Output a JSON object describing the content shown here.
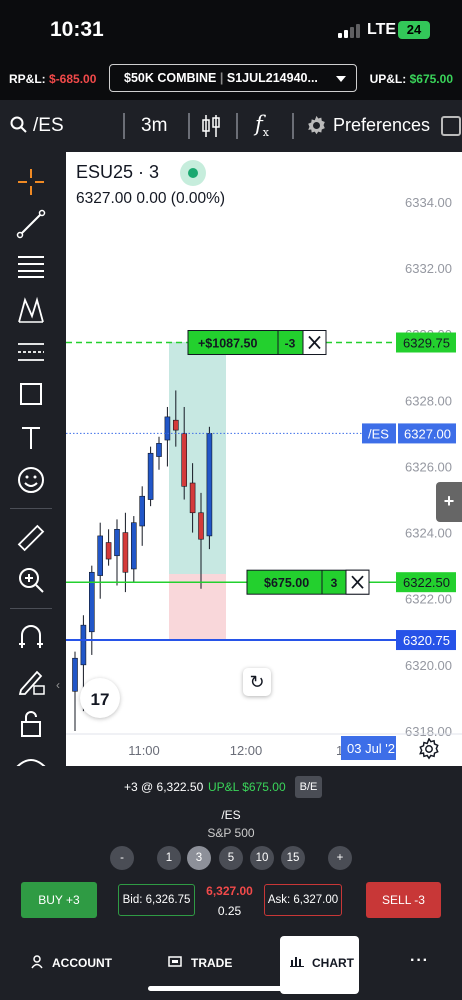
{
  "status_bar": {
    "time": "10:31",
    "network": "LTE",
    "battery": "24"
  },
  "account_bar": {
    "rpl_label": "RP&L:",
    "rpl_value": "$-685.00",
    "account": "$50K COMBINE",
    "account_id": "S1JUL214940...",
    "upl_label": "UP&L:",
    "upl_value": "$675.00"
  },
  "toolbar": {
    "symbol": "/ES",
    "interval": "3m",
    "fx": "f",
    "preferences": "Preferences"
  },
  "chart": {
    "title": "ESU25 · 3",
    "ohlc": "6327.00 0.00 (0.00%)",
    "price_labels": [
      "6334.00",
      "6332.00",
      "6330.00",
      "6328.00",
      "6326.00",
      "6324.00",
      "6322.00",
      "6320.00",
      "6318.00"
    ],
    "time_labels": [
      "11:00",
      "12:00",
      "13"
    ],
    "date_badge": "03 Jul '2",
    "orders": {
      "target": {
        "label": "+$1087.50",
        "qty": "-3",
        "price": "6329.75"
      },
      "position": {
        "label": "$675.00",
        "qty": "3",
        "price": "6322.50"
      },
      "stop": {
        "price": "6320.75"
      },
      "last": {
        "symbol": "/ES",
        "price": "6327.00"
      }
    },
    "tv_logo": "17",
    "colors": {
      "up": "#2156c8",
      "down": "#d43a3a",
      "target": "#23d02e",
      "stop": "#2753e8",
      "last": "#3d6ee8"
    }
  },
  "panel": {
    "position": "+3 @ 6,322.50",
    "upl": "UP&L $675.00",
    "be": "B/E",
    "symbol": "/ES",
    "name": "S&P 500",
    "quantities": [
      "-",
      "1",
      "3",
      "5",
      "10",
      "15",
      "+"
    ],
    "buy": "BUY +3",
    "bid": "Bid: 6,326.75",
    "last": "6,327.00",
    "tick": "0.25",
    "ask": "Ask: 6,327.00",
    "sell": "SELL -3"
  },
  "nav": {
    "account": "ACCOUNT",
    "trade": "TRADE",
    "chart": "CHART",
    "more": "···"
  }
}
